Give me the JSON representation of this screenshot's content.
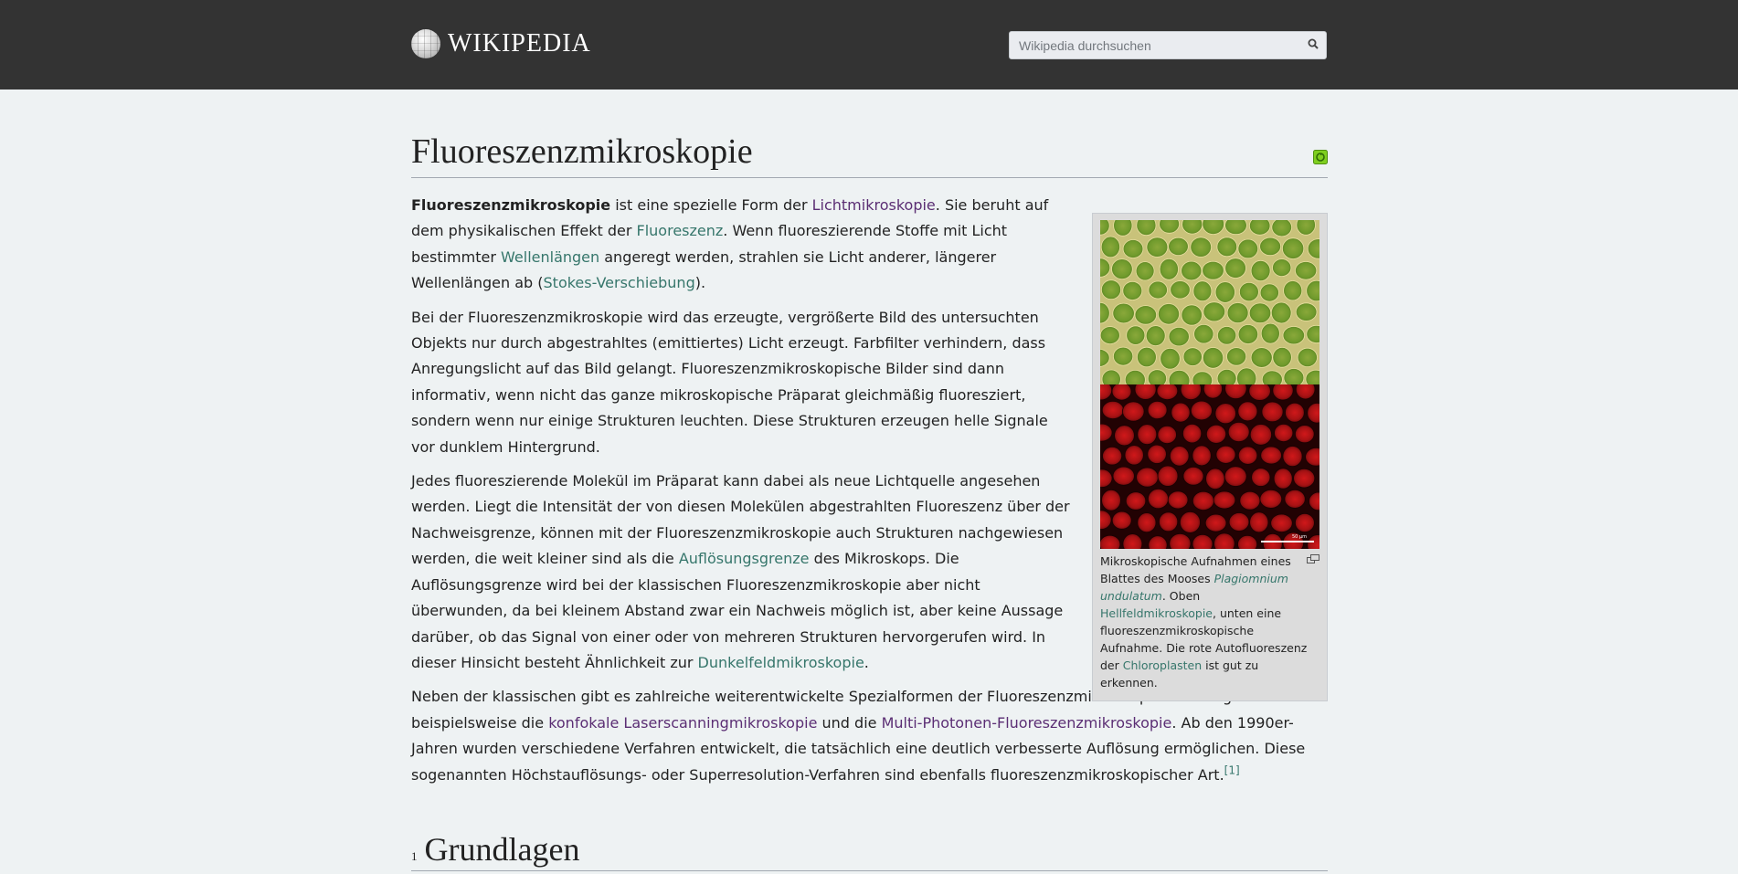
{
  "header": {
    "logo_text": "WIKIPEDIA",
    "search_placeholder": "Wikipedia durchsuchen"
  },
  "article": {
    "title": "Fluoreszenzmikroskopie",
    "p1": {
      "bold": "Fluoreszenzmikroskopie",
      "t1": " ist eine spezielle Form der ",
      "l1": "Lichtmikroskopie",
      "t2": ". Sie beruht auf dem physikalischen Effekt der ",
      "l2": "Fluoreszenz",
      "t3": ". Wenn fluoreszierende Stoffe mit Licht bestimmter ",
      "l3": "Wellenlängen",
      "t4": " angeregt werden, strahlen sie Licht anderer, längerer Wellenlängen ab (",
      "l4": "Stokes-Verschiebung",
      "t5": ")."
    },
    "p2": "Bei der Fluoreszenzmikroskopie wird das erzeugte, vergrößerte Bild des untersuchten Objekts nur durch abgestrahltes (emittiertes) Licht erzeugt. Farbfilter verhindern, dass Anregungslicht auf das Bild gelangt. Fluoreszenzmikroskopische Bilder sind dann informativ, wenn nicht das ganze mikroskopische Präparat gleichmäßig fluoresziert, sondern wenn nur einige Strukturen leuchten. Diese Strukturen erzeugen helle Signale vor dunklem Hintergrund.",
    "p3": {
      "t1": "Jedes fluoreszierende Molekül im Präparat kann dabei als neue Lichtquelle angesehen werden. Liegt die Intensität der von diesen Molekülen abgestrahlten Fluoreszenz über der Nachweisgrenze, können mit der Fluoreszenzmikroskopie auch Strukturen nachgewiesen werden, die weit kleiner sind als die ",
      "l1": "Auflösungsgrenze",
      "t2": " des Mikroskops. Die Auflösungsgrenze wird bei der klassischen Fluoreszenzmikroskopie aber nicht überwunden, da bei kleinem Abstand zwar ein Nachweis möglich ist, aber keine Aussage darüber, ob das Signal von einer oder von mehreren Strukturen hervorgerufen wird. In dieser Hinsicht besteht Ähnlichkeit zur ",
      "l2": "Dunkelfeldmikroskopie",
      "t3": "."
    },
    "p4": {
      "t1": "Neben der klassischen gibt es zahlreiche weiterentwickelte Spezialformen der Fluoreszenzmikroskopie. Hierzu gehören beispielsweise die ",
      "l1": "konfokale Laserscanningmikroskopie",
      "t2": " und die ",
      "l2": "Multi-Photonen-Fluoreszenzmikroskopie",
      "t3": ". Ab den 1990er-Jahren wurden verschiedene Verfahren entwickelt, die tatsächlich eine deutlich verbesserte Auflösung ermöglichen. Diese sogenannten Höchstauflösungs- oder Superresolution-Verfahren sind ebenfalls fluoreszenzmikroskopischer Art.",
      "ref": "[1]"
    },
    "section": {
      "number": "1",
      "title": "Grundlagen"
    }
  },
  "figure": {
    "scale_label": "50 µm",
    "caption": {
      "t1": "Mikroskopische Aufnahmen eines Blattes des Mooses ",
      "italic_link": "Plagiomnium undulatum",
      "t2": ". Oben ",
      "l1": "Hellfeldmikroskopie",
      "t3": ", unten eine fluoreszenzmikroskopische Aufnahme. Die rote Autofluoreszenz der ",
      "l2": "Chloroplasten",
      "t4": " ist gut zu erkennen."
    }
  },
  "colors": {
    "header_bg": "#333333",
    "page_bg": "#eef2f3",
    "link": "#36766b",
    "visited_link": "#5b2e74"
  }
}
